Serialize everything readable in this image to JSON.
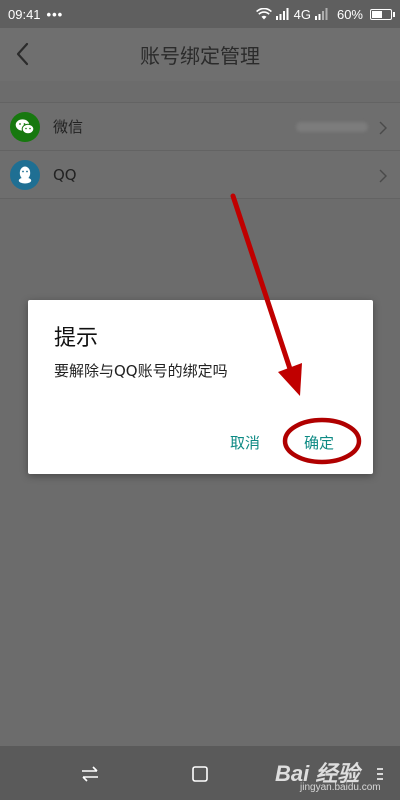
{
  "status_bar": {
    "time": "09:41",
    "dots": "•••",
    "network": "4G",
    "battery_text": "60%",
    "battery_level": 0.6
  },
  "header": {
    "title": "账号绑定管理",
    "back_icon": "chevron-left-icon"
  },
  "accounts": [
    {
      "label": "微信",
      "icon": "wechat-icon",
      "icon_color": "#17780f"
    },
    {
      "label": "QQ",
      "icon": "qq-icon",
      "icon_color": "#1f6f93"
    }
  ],
  "dialog": {
    "title": "提示",
    "message": "要解除与QQ账号的绑定吗",
    "cancel_label": "取消",
    "confirm_label": "确定",
    "accent_color": "#0d8a84"
  },
  "annotation": {
    "arrow_color": "#c00000",
    "circle_color": "#b00000"
  },
  "watermark": {
    "text": "Bai 经验",
    "sub_text": "jingyan.baidu.com"
  }
}
